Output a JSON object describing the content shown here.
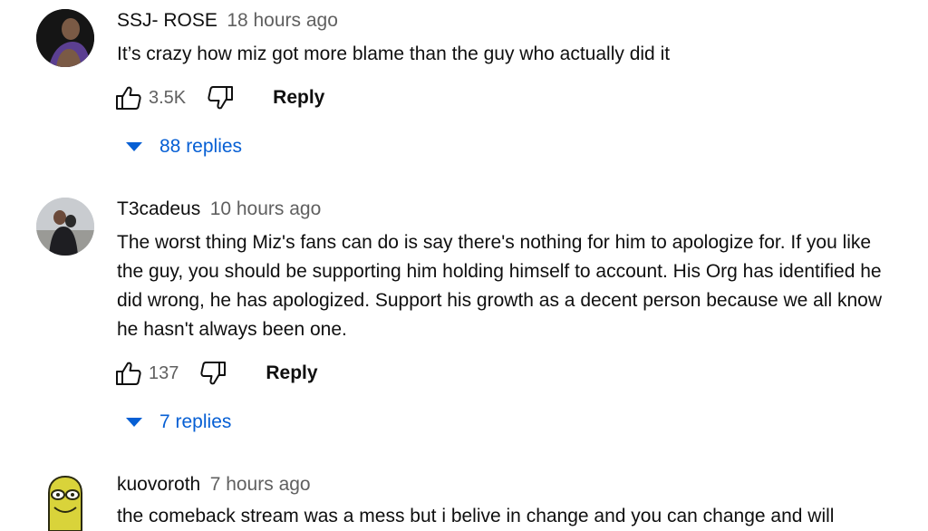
{
  "comments": [
    {
      "author": "SSJ- ROSE",
      "time": "18 hours ago",
      "text": "It’s crazy how miz got more blame than the guy who actually did it",
      "likes": "3.5K",
      "reply_label": "Reply",
      "replies_label": "88 replies",
      "avatar_icon": "user-avatar-photo"
    },
    {
      "author": "T3cadeus",
      "time": "10 hours ago",
      "text": "The worst thing Miz's fans can do is say there's nothing for him to apologize for. If you like the guy, you should be supporting him holding himself to account. His Org has identified he did wrong, he has apologized. Support his growth as a decent person because we all know he hasn't always been one.",
      "likes": "137",
      "reply_label": "Reply",
      "replies_label": "7 replies",
      "avatar_icon": "user-avatar-photo"
    },
    {
      "author": "kuovoroth",
      "time": "7 hours ago",
      "text": "the comeback stream was a mess but i belive in change and you can change and will",
      "avatar_icon": "cartoon-avatar"
    }
  ],
  "colors": {
    "link_blue": "#065fd4",
    "meta_gray": "#606060",
    "text": "#0f0f0f"
  },
  "icons": [
    "thumbs-up-icon",
    "thumbs-down-icon",
    "caret-down-icon"
  ]
}
